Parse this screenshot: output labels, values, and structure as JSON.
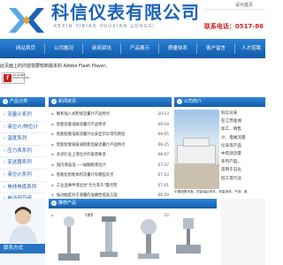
{
  "header": {
    "company_name": "科信仪表有限公司",
    "pinyin": "KEXIN YIBIAO YOUXIAN GONGSI",
    "toplink_1": "设为首页",
    "toplink_2": "加入收藏",
    "hotline_label": "联系电话：",
    "hotline_number": "0517-86"
  },
  "nav": {
    "items": [
      {
        "label": "网站首页"
      },
      {
        "label": "公司概况"
      },
      {
        "label": "新闻资讯"
      },
      {
        "label": "产品展示"
      },
      {
        "label": "质量体系"
      },
      {
        "label": "客户留言"
      },
      {
        "label": "人才招聘"
      }
    ]
  },
  "flash": {
    "notice": "此页面上的内容需要较新版本的 Adobe Flash Player。",
    "badge_line1": "Get ADOBE®",
    "badge_line2": "FLASH® PLAYER"
  },
  "products": {
    "title": "产品分类",
    "items": [
      {
        "label": "流量计系列"
      },
      {
        "label": "液位计/物位计"
      },
      {
        "label": "温度系列"
      },
      {
        "label": "压力表系列"
      },
      {
        "label": "变送器系列"
      },
      {
        "label": "液位计系列"
      },
      {
        "label": "电线电缆系列"
      },
      {
        "label": "电动调节阀"
      }
    ]
  },
  "news": {
    "title": "新闻资讯",
    "items": [
      {
        "title": "解析插入式靶式流量计产品特点",
        "date": "10-13"
      },
      {
        "title": "智能双基电磁流量计产品特点",
        "date": "09-19"
      },
      {
        "title": "智能智能电磁流量计仪表显示异常的原因",
        "date": "09-05"
      },
      {
        "title": "智能智能调直调智能电磁流量计产品特点",
        "date": "08-25"
      },
      {
        "title": "水泥行业上液位计的安装要求",
        "date": "08-07"
      },
      {
        "title": "国内液晶电——磁翻板液位计",
        "date": "07-27"
      },
      {
        "title": "智能化智能体积流量计有哪些优点",
        "date": "07-23"
      },
      {
        "title": "工业品事件液位达\"合九等于\"暨点赞",
        "date": "07-01"
      },
      {
        "title": "振动幅度对于测量的准确性提高方案",
        "date": "06-20"
      },
      {
        "title": "智能型产品对于所测的气体流量",
        "date": "06-07"
      },
      {
        "title": "选择电子自动化气体检测准确的方式",
        "date": "05-22"
      }
    ]
  },
  "company_intro": {
    "title": "公司简介",
    "lines": [
      "科信仪表",
      "在江苏金湖",
      "加工、销售",
      "计，电磁流量",
      "仪表等产品",
      "中有测流量",
      "系列产品，",
      "适用于石化",
      "轻工等行业"
    ],
    "body_lines": [
      "半集团基本面，质量保证体系，测量液体、气体、蒸",
      "汽流量计，液位计，执行器，涡轮",
      "式流量计，质量流量计，智能",
      "流量计，差压式流量计，蒸",
      "锅炉，消防，暖通，供热等"
    ]
  },
  "contact": {
    "title": "联系方式"
  },
  "recommend": {
    "title": "推荐产品"
  }
}
